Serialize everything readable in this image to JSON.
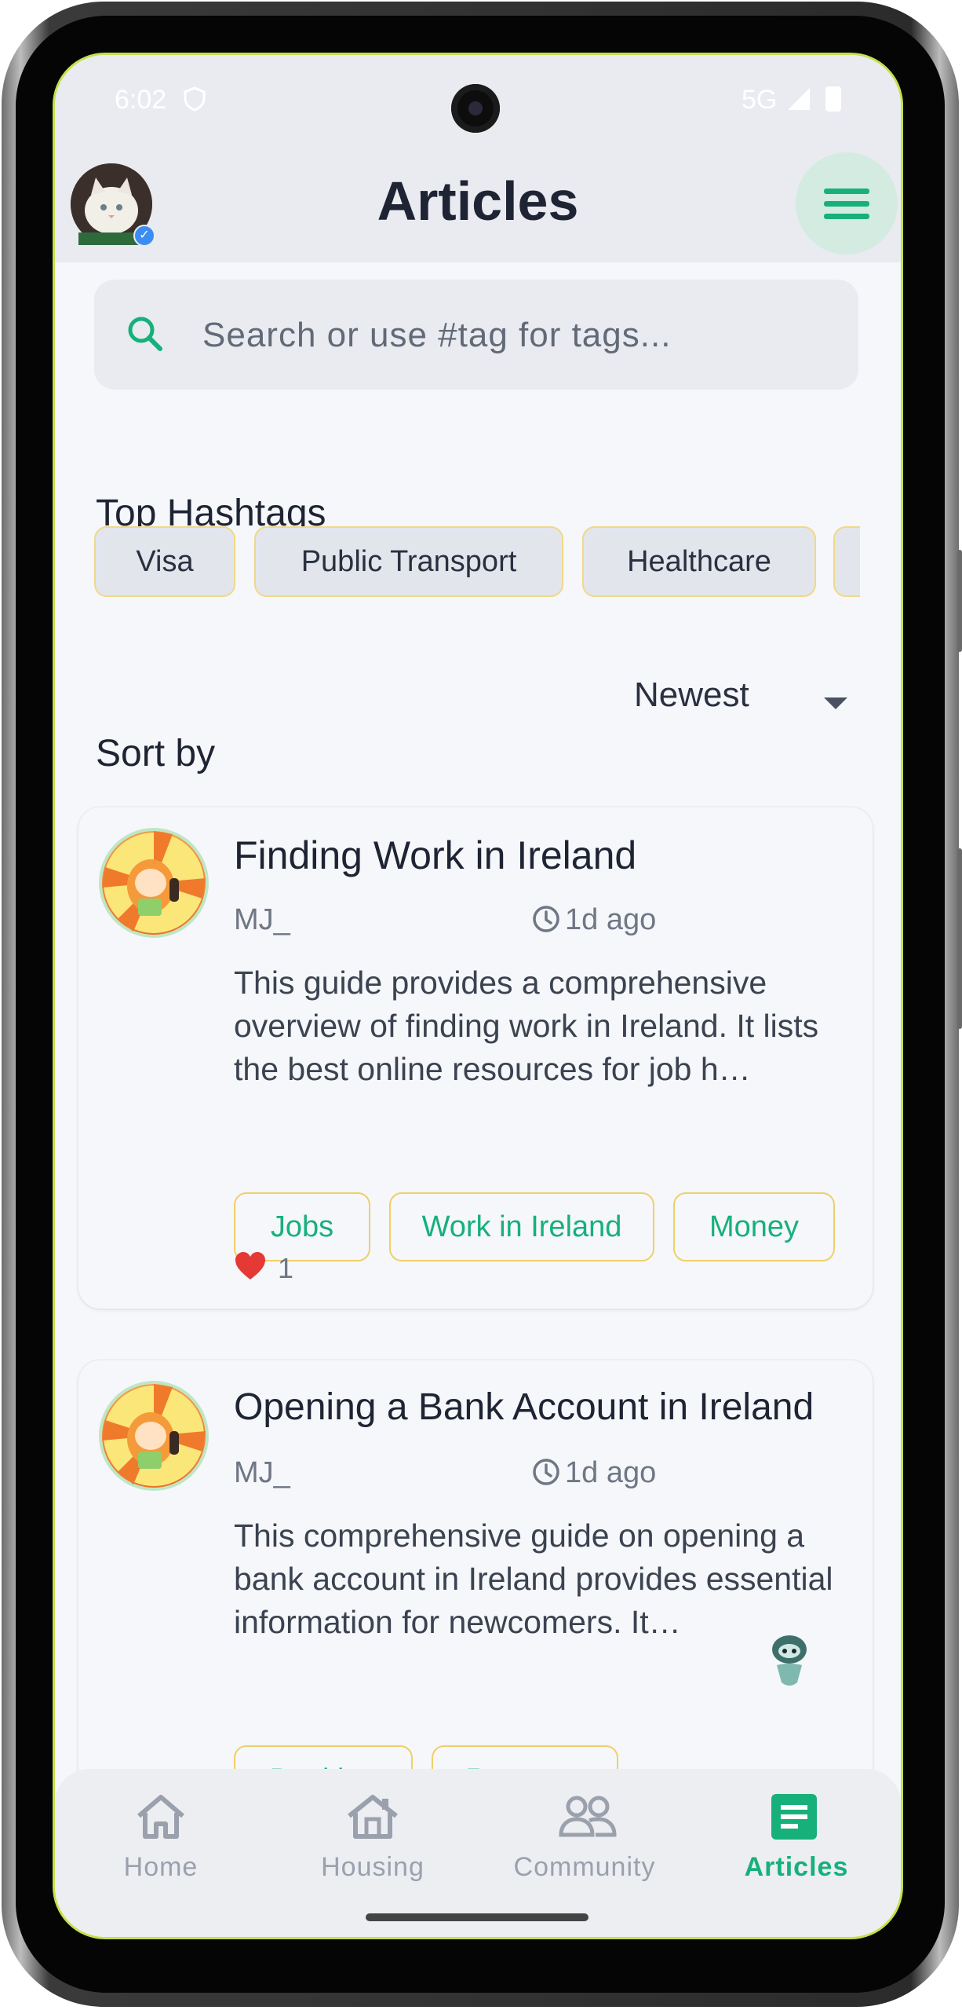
{
  "status_bar": {
    "time": "6:02",
    "network": "5G"
  },
  "header": {
    "title": "Articles"
  },
  "search": {
    "placeholder": "Search or use #tag for tags..."
  },
  "hashtags": {
    "title": "Top Hashtags",
    "items": [
      "Visa",
      "Public Transport",
      "Healthcare",
      ""
    ]
  },
  "sort": {
    "label": "Sort by",
    "value": "Newest"
  },
  "articles": [
    {
      "title": "Finding Work in Ireland",
      "author": "MJ_",
      "time": "1d ago",
      "excerpt": "This guide provides a comprehensive overview of finding work in Ireland. It lists the best online resources for job h…",
      "tags": [
        "Jobs",
        "Work in Ireland",
        "Money"
      ],
      "likes": "1"
    },
    {
      "title": "Opening a Bank Account in Ireland",
      "author": "MJ_",
      "time": "1d ago",
      "excerpt": "This comprehensive guide on opening a bank account in Ireland provides essential information for newcomers. It…",
      "tags": [
        "Banking",
        "Revenue"
      ]
    }
  ],
  "nav": {
    "items": [
      {
        "label": "Home",
        "icon": "home-icon"
      },
      {
        "label": "Housing",
        "icon": "housing-icon"
      },
      {
        "label": "Community",
        "icon": "community-icon"
      },
      {
        "label": "Articles",
        "icon": "articles-icon",
        "active": true
      }
    ]
  },
  "colors": {
    "accent": "#17b07b",
    "tag_border": "#f0cf6a",
    "heart": "#e53935",
    "text_dark": "#1e2433"
  }
}
